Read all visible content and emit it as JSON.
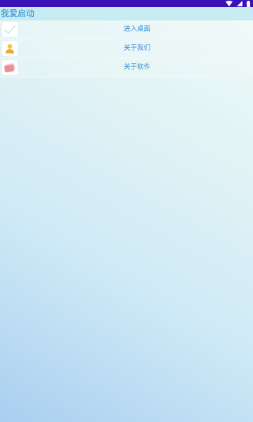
{
  "status_bar": {
    "color": "#3a12b8",
    "icons": [
      "wifi-icon",
      "signal-icon",
      "battery-icon"
    ]
  },
  "app_bar": {
    "title": "我爱启动",
    "title_color": "#2f86d6"
  },
  "menu": {
    "items": [
      {
        "label": "进入桌面",
        "icon": "check-icon"
      },
      {
        "label": "关于我们",
        "icon": "user-icon"
      },
      {
        "label": "关于软件",
        "icon": "card-icon"
      }
    ],
    "label_color": "#3b8fd8"
  }
}
